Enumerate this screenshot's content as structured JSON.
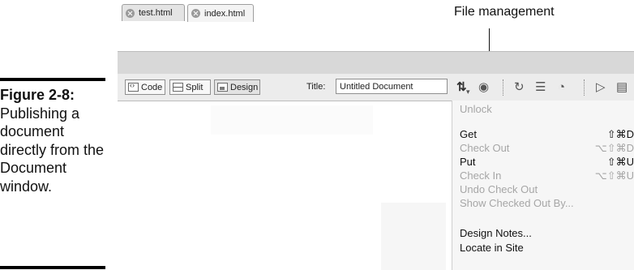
{
  "callout": {
    "label": "File management"
  },
  "caption": {
    "figure": "Figure 2-8:",
    "text": "Publishing a document directly from the Document window."
  },
  "tabs": [
    {
      "label": "test.html",
      "active": false
    },
    {
      "label": "index.html",
      "active": true
    }
  ],
  "toolbar": {
    "view_buttons": [
      {
        "label": "Code",
        "icon": "code-view-icon"
      },
      {
        "label": "Split",
        "icon": "split-view-icon"
      },
      {
        "label": "Design",
        "icon": "design-view-icon",
        "selected": true
      }
    ],
    "title_label": "Title:",
    "title_value": "Untitled Document",
    "icons": [
      "file-management-icon",
      "preview-browser-icon",
      "refresh-icon",
      "view-options-icon",
      "visual-aids-icon",
      "validate-icon"
    ]
  },
  "file_menu": {
    "items": [
      {
        "label": "Unlock",
        "shortcut": "",
        "enabled": false
      },
      {
        "label": "Get",
        "shortcut": "⇧⌘D",
        "enabled": true
      },
      {
        "label": "Check Out",
        "shortcut": "⌥⇧⌘D",
        "enabled": false
      },
      {
        "label": "Put",
        "shortcut": "⇧⌘U",
        "enabled": true
      },
      {
        "label": "Check In",
        "shortcut": "⌥⇧⌘U",
        "enabled": false
      },
      {
        "label": "Undo Check Out",
        "shortcut": "",
        "enabled": false
      },
      {
        "label": "Show Checked Out By...",
        "shortcut": "",
        "enabled": false
      },
      {
        "label": "Design Notes...",
        "shortcut": "",
        "enabled": true
      },
      {
        "label": "Locate in Site",
        "shortcut": "",
        "enabled": true
      }
    ]
  }
}
